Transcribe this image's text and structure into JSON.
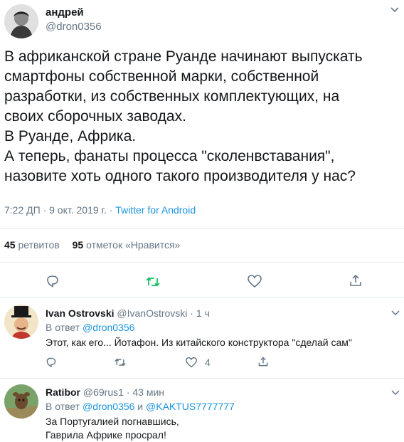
{
  "main_tweet": {
    "author_name": "андрей",
    "author_handle": "@dron0356",
    "text_lines": [
      "В африканской стране Руанде начинают выпускать",
      "смартфоны собственной марки, собственной",
      "разработки, из собственных комплектующих, на",
      "своих сборочных заводах.",
      "В Руанде, Африка.",
      "А теперь, фанаты процесса \"сколенвставания\",",
      "назовите хоть одного такого производителя у нас?"
    ],
    "timestamp": "7:22 ДП · 9 окт. 2019 г. · ",
    "source": "Twitter for Android",
    "retweets_count": "45",
    "retweets_label": "ретвитов",
    "likes_count": "95",
    "likes_label": "отметок «Нравится»"
  },
  "replies": [
    {
      "author_name": "Ivan Ostrovski",
      "author_handle": "@IvanOstrovski",
      "time": "· 1 ч",
      "reply_to_prefix": "В ответ ",
      "reply_to_1": "@dron0356",
      "text": "Этот, как его... Йотафон. Из китайского конструктора \"сделай сам\"",
      "likes": "4"
    },
    {
      "author_name": "Ratibor",
      "author_handle": "@69rus1",
      "time": "· 43 мин",
      "reply_to_prefix": "В ответ ",
      "reply_to_1": "@dron0356",
      "reply_to_and": " и ",
      "reply_to_2": "@KAKTUS7777777",
      "text_line1": "За Португалией погнавшись,",
      "text_line2": "Гаврила Африке просрал!"
    }
  ],
  "colors": {
    "accent": "#1b95e0",
    "retweet_green": "#17bf63",
    "secondary": "#657786",
    "divider": "#e6ecf0"
  },
  "icons": [
    "reply-icon",
    "retweet-icon",
    "like-icon",
    "share-icon",
    "chevron-down-icon"
  ]
}
